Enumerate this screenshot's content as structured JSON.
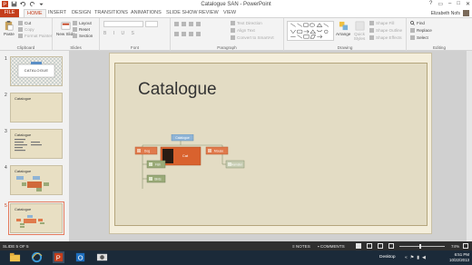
{
  "app": {
    "window_title": "Catalogue SAN - PowerPoint",
    "window_controls": [
      "?",
      "▭",
      "–",
      "□",
      "✕"
    ]
  },
  "colors": {
    "accent": "#c43e1c",
    "slide_bg": "#e3dcc4",
    "org_orange": "#e07a4c",
    "org_green": "#9aaa78",
    "org_blue": "#8fb4d6"
  },
  "tabs": [
    "FILE",
    "HOME",
    "INSERT",
    "DESIGN",
    "TRANSITIONS",
    "ANIMATIONS",
    "SLIDE SHOW",
    "REVIEW",
    "VIEW"
  ],
  "user": {
    "name": "Elizabeth Nofs"
  },
  "ribbon": {
    "clipboard": {
      "paste": "Paste",
      "cut": "Cut",
      "copy": "Copy",
      "format_painter": "Format Painter",
      "label": "Clipboard"
    },
    "slides": {
      "new_slide": "New Slide",
      "layout": "Layout",
      "reset": "Reset",
      "section": "Section",
      "label": "Slides"
    },
    "font": {
      "label": "Font"
    },
    "paragraph": {
      "text_direction": "Text Direction",
      "align_text": "Align Text",
      "smartart": "Convert to SmartArt",
      "label": "Paragraph"
    },
    "drawing": {
      "arrange": "Arrange",
      "quick_styles": "Quick Styles",
      "shape_fill": "Shape Fill",
      "shape_outline": "Shape Outline",
      "shape_effects": "Shape Effects",
      "label": "Drawing"
    },
    "editing": {
      "find": "Find",
      "replace": "Replace",
      "select": "Select",
      "label": "Editing"
    }
  },
  "slides": [
    {
      "num": "1",
      "title": "CATALOGUE"
    },
    {
      "num": "2",
      "title": "Catalogue"
    },
    {
      "num": "3",
      "title": "Catalogue"
    },
    {
      "num": "4",
      "title": "Catalogue"
    },
    {
      "num": "5",
      "title": "Catalogue"
    }
  ],
  "main_slide": {
    "title": "Catalogue",
    "org": {
      "top": "Catalogue",
      "left": "Dog",
      "center": "Cat",
      "right": "Mouse",
      "sub1": "Fish",
      "sub2": "Birds",
      "right_sub": "Hamster"
    }
  },
  "status": {
    "slide_counter": "SLIDE 5 OF 5",
    "notes": "NOTES",
    "comments": "COMMENTS",
    "zoom": "74%"
  },
  "taskbar": {
    "desktop": "Desktop",
    "time": "6:51 PM",
    "date": "10/22/2013"
  }
}
